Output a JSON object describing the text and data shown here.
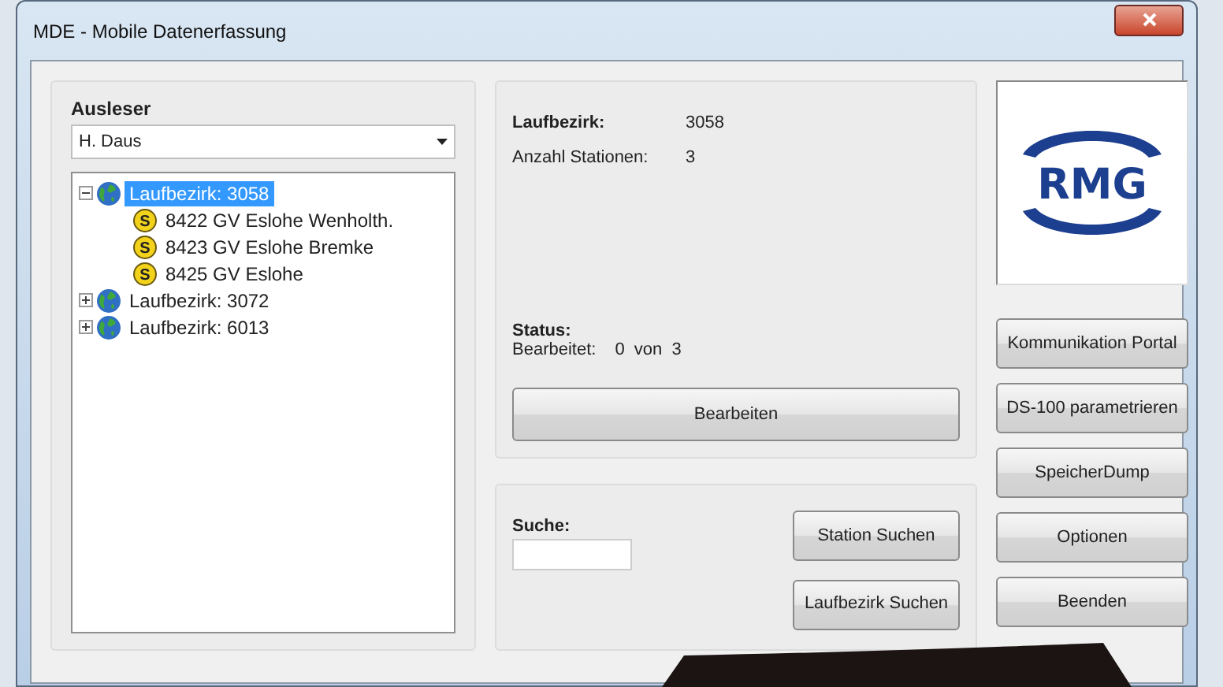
{
  "window": {
    "title": "MDE - Mobile Datenerfassung"
  },
  "reader": {
    "label": "Ausleser",
    "value": "H. Daus"
  },
  "tree": [
    {
      "kind": "district",
      "label": "Laufbezirk: 3058",
      "selected": true,
      "expanded": true,
      "children": [
        {
          "kind": "station",
          "badge": "S",
          "label": "8422  GV Eslohe Wenholth.",
          "selected": false
        },
        {
          "kind": "station",
          "badge": "S",
          "label": "8423  GV Eslohe Bremke",
          "selected": false
        },
        {
          "kind": "station",
          "badge": "S",
          "label": "8425  GV Eslohe",
          "selected": false
        }
      ]
    },
    {
      "kind": "district",
      "label": "Laufbezirk: 3072",
      "selected": false,
      "expanded": false
    },
    {
      "kind": "district",
      "label": "Laufbezirk: 6013",
      "selected": false,
      "expanded": false
    }
  ],
  "details": {
    "district_label": "Laufbezirk:",
    "district_value": "3058",
    "stations_label": "Anzahl Stationen:",
    "stations_value": "3",
    "status_label": "Status:",
    "processed_label": "Bearbeitet:",
    "processed_value": "0  von  3",
    "edit_button": "Bearbeiten"
  },
  "search": {
    "label": "Suche:",
    "buttons": [
      "Station Suchen",
      "Laufbezirk Suchen"
    ]
  },
  "logo": {
    "text": "RMG"
  },
  "side_buttons": [
    "Kommunikation Portal",
    "DS-100 parametrieren",
    "SpeicherDump",
    "Optionen",
    "Beenden"
  ]
}
